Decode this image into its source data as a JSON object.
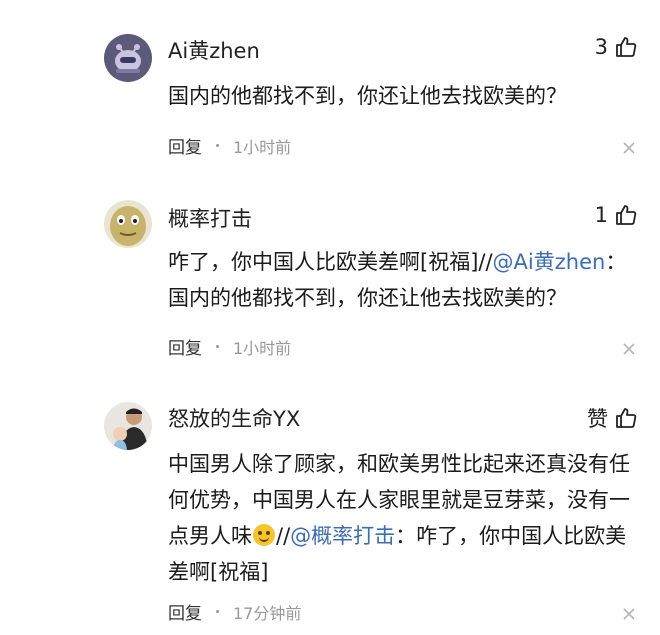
{
  "comments": [
    {
      "user": "Ai黄zhen",
      "likes": "3",
      "text": "国内的他都找不到，你还让他去找欧美的？",
      "reply_label": "回复",
      "time": "1小时前"
    },
    {
      "user": "概率打击",
      "likes": "1",
      "text_before": "咋了，你中国人比欧美差啊[祝福]//",
      "mention": "@Ai黄zhen",
      "text_after": "：国内的他都找不到，你还让他去找欧美的？",
      "reply_label": "回复",
      "time": "1小时前"
    },
    {
      "user": "怒放的生命YX",
      "likes": "赞",
      "text_before": "中国男人除了顾家，和欧美男性比起来还真没有任何优势，中国男人在人家眼里就是豆芽菜，没有一点男人味",
      "text_mid": "//",
      "mention": "@概率打击",
      "text_after": "：咋了，你中国人比欧美差啊[祝福]",
      "reply_label": "回复",
      "time": "17分钟前"
    }
  ],
  "icons": {
    "like": "thumbs-up-icon",
    "close": "close-icon",
    "emoji": "laughing-emoji-icon"
  }
}
